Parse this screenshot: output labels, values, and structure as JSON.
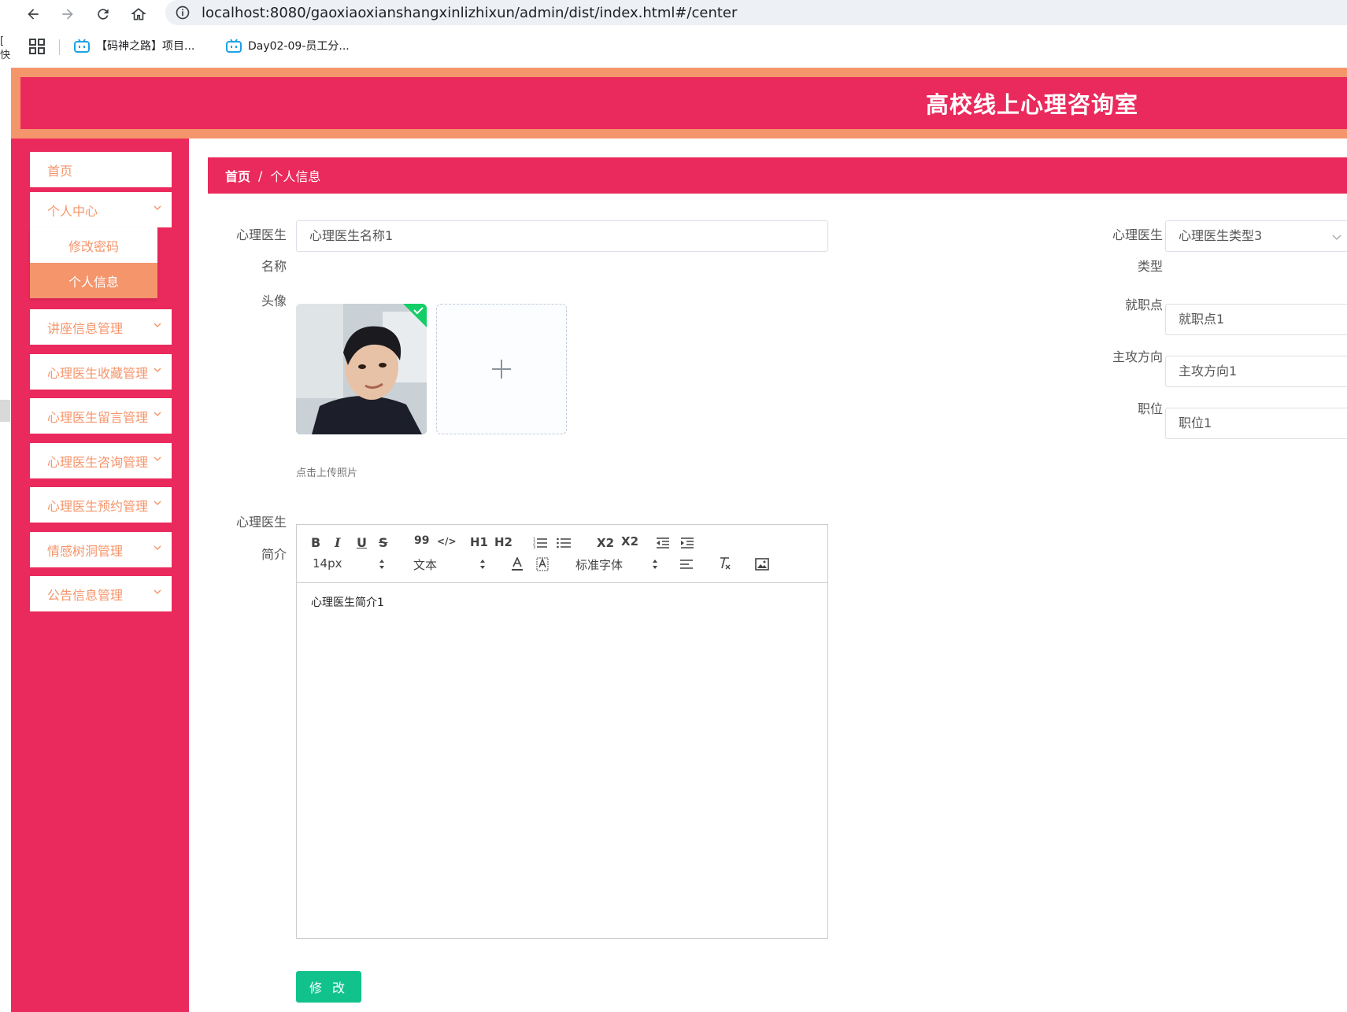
{
  "browser": {
    "url": "localhost:8080/gaoxiaoxianshangxinlizhixun/admin/dist/index.html#/center",
    "bookmarks": [
      {
        "label": "【码神之路】项目..."
      },
      {
        "label": "Day02-09-员工分..."
      }
    ],
    "left_edge_text": "[ 快"
  },
  "header": {
    "title": "高校线上心理咨询室"
  },
  "sidebar": {
    "items": [
      {
        "label": "首页"
      },
      {
        "label": "个人中心"
      },
      {
        "label": "讲座信息管理"
      },
      {
        "label": "心理医生收藏管理"
      },
      {
        "label": "心理医生留言管理"
      },
      {
        "label": "心理医生咨询管理"
      },
      {
        "label": "心理医生预约管理"
      },
      {
        "label": "情感树洞管理"
      },
      {
        "label": "公告信息管理"
      }
    ],
    "submenu": [
      {
        "label": "修改密码"
      },
      {
        "label": "个人信息"
      }
    ]
  },
  "breadcrumb": {
    "home": "首页",
    "separator": "/",
    "current": "个人信息"
  },
  "form": {
    "name_label_line1": "心理医生",
    "name_label_line2": "名称",
    "name_value": "心理医生名称1",
    "type_label_line1": "心理医生",
    "type_label_line2": "类型",
    "type_value": "心理医生类型3",
    "avatar_label": "头像",
    "upload_tip": "点击上传照片",
    "workplace_label": "就职点",
    "workplace_value": "就职点1",
    "direction_label": "主攻方向",
    "direction_value": "主攻方向1",
    "position_label": "职位",
    "position_value": "职位1",
    "intro_label_line1": "心理医生",
    "intro_label_line2": "简介",
    "intro_value": "心理医生简介1",
    "submit_label": "修 改"
  },
  "editor_toolbar": {
    "bold": "B",
    "italic": "I",
    "underline": "U",
    "strike": "S",
    "quote": "99",
    "code": "</>",
    "h1": "H1",
    "h2": "H2",
    "subscript": "X2",
    "superscript": "X2",
    "size": "14px",
    "header": "文本",
    "font": "标准字体"
  },
  "colors": {
    "primary": "#ea2a5c",
    "accent": "#f5956b",
    "submit": "#12c28d"
  }
}
